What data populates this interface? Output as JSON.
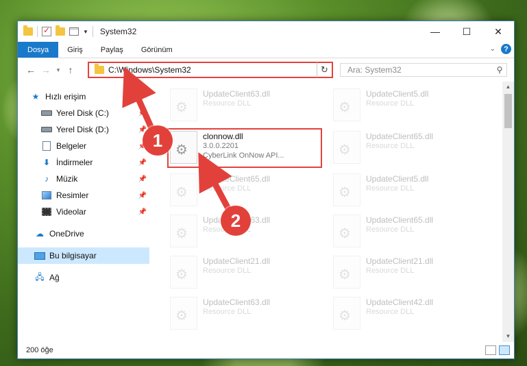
{
  "window": {
    "title": "System32",
    "controls": {
      "minimize": "—",
      "maximize": "☐",
      "close": "✕"
    }
  },
  "ribbon": {
    "tabs": [
      "Dosya",
      "Giriş",
      "Paylaş",
      "Görünüm"
    ],
    "help": "?"
  },
  "address_bar": {
    "path": "C:\\Windows\\System32",
    "search_placeholder": "Ara: System32"
  },
  "sidebar": {
    "items": [
      {
        "label": "Hızlı erişim",
        "icon": "star-icon",
        "pinned": false
      },
      {
        "label": "Yerel Disk (C:)",
        "icon": "drive-icon",
        "pinned": true
      },
      {
        "label": "Yerel Disk (D:)",
        "icon": "drive-icon",
        "pinned": true
      },
      {
        "label": "Belgeler",
        "icon": "documents-icon",
        "pinned": true
      },
      {
        "label": "İndirmeler",
        "icon": "download-icon",
        "pinned": true
      },
      {
        "label": "Müzik",
        "icon": "music-icon",
        "pinned": true
      },
      {
        "label": "Resimler",
        "icon": "pictures-icon",
        "pinned": true
      },
      {
        "label": "Videolar",
        "icon": "video-icon",
        "pinned": true
      },
      {
        "label": "OneDrive",
        "icon": "cloud-icon",
        "pinned": false
      },
      {
        "label": "Bu bilgisayar",
        "icon": "computer-icon",
        "pinned": false,
        "selected": true
      },
      {
        "label": "Ağ",
        "icon": "network-icon",
        "pinned": false
      }
    ]
  },
  "files": {
    "left": [
      {
        "name": "UpdateClient63.dll",
        "type": "Resource DLL",
        "faded": true
      },
      {
        "name": "clonnow.dll",
        "version": "3.0.0.2201",
        "description": "CyberLink OnNow API...",
        "faded": false
      },
      {
        "name": "UpdateClient65.dll",
        "type": "Resource DLL",
        "faded": true
      },
      {
        "name": "UpdateClient63.dll",
        "type": "Resource DLL",
        "faded": true
      },
      {
        "name": "UpdateClient21.dll",
        "type": "Resource DLL",
        "faded": true
      },
      {
        "name": "UpdateClient63.dll",
        "type": "Resource DLL",
        "faded": true
      }
    ],
    "right": [
      {
        "name": "UpdateClient5.dll",
        "type": "Resource DLL"
      },
      {
        "name": "UpdateClient65.dll",
        "type": "Resource DLL"
      },
      {
        "name": "UpdateClient5.dll",
        "type": "Resource DLL"
      },
      {
        "name": "UpdateClient65.dll",
        "type": "Resource DLL"
      },
      {
        "name": "UpdateClient21.dll",
        "type": "Resource DLL"
      },
      {
        "name": "UpdateClient42.dll",
        "type": "Resource DLL"
      }
    ]
  },
  "status": {
    "item_count": "200 öğe"
  },
  "annotations": {
    "step1": "1",
    "step2": "2",
    "color": "#e2413b"
  }
}
